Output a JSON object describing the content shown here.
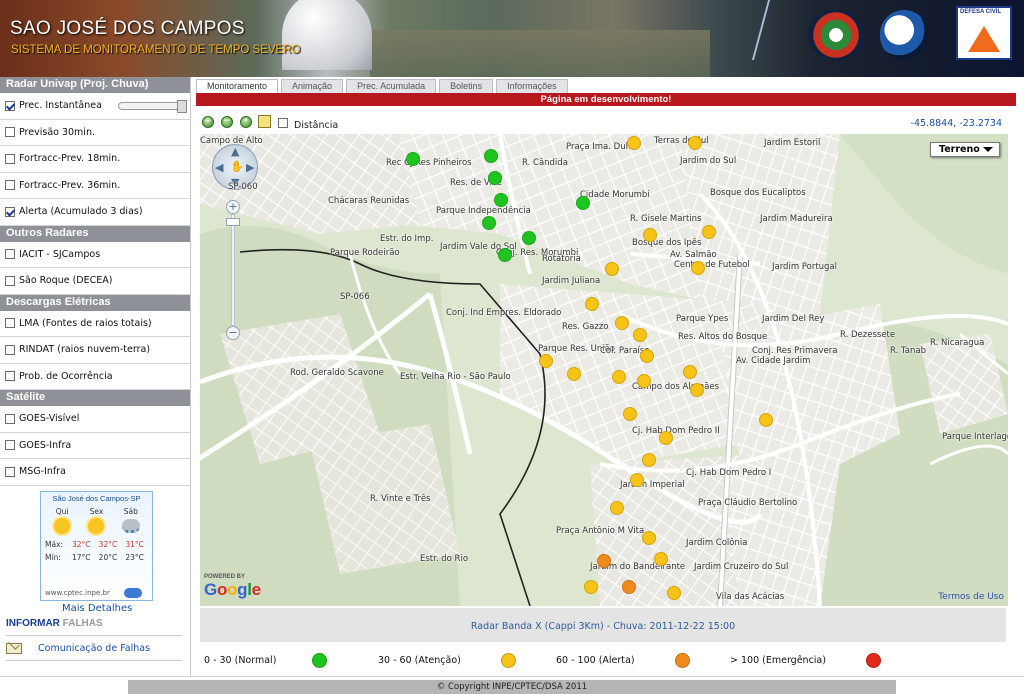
{
  "header": {
    "title": "SAO JOSÉ DOS CAMPOS",
    "subtitle": "SISTEMA DE MONITORAMENTO DE TEMPO SEVERO",
    "logo_label_3": "DEFESA CIVIL",
    "logos": [
      "pro-inovacao-logo",
      "inpe-logo",
      "defesa-civil-logo"
    ]
  },
  "sidebar": {
    "sections": [
      {
        "title": "Radar Univap (Proj. Chuva)",
        "items": [
          {
            "label": "Prec. Instantânea",
            "checked": true,
            "slider": true
          },
          {
            "label": "Previsão 30min.",
            "checked": false
          },
          {
            "label": "Fortracc-Prev. 18min.",
            "checked": false
          },
          {
            "label": "Fortracc-Prev. 36min.",
            "checked": false
          },
          {
            "label": "Alerta (Acumulado 3 dias)",
            "checked": true
          }
        ]
      },
      {
        "title": "Outros Radares",
        "items": [
          {
            "label": "IACIT - SJCampos",
            "checked": false
          },
          {
            "label": "São Roque (DECEA)",
            "checked": false
          }
        ]
      },
      {
        "title": "Descargas Elétricas",
        "items": [
          {
            "label": "LMA (Fontes de raios totais)",
            "checked": false
          },
          {
            "label": "RINDAT (raios nuvem-terra)",
            "checked": false
          },
          {
            "label": "Prob. de Ocorrência",
            "checked": false
          }
        ]
      },
      {
        "title": "Satélite",
        "items": [
          {
            "label": "GOES-Visível",
            "checked": false
          },
          {
            "label": "GOES-Infra",
            "checked": false
          },
          {
            "label": "MSG-Infra",
            "checked": false
          }
        ]
      }
    ],
    "weather": {
      "title": "São José dos Campos-SP",
      "days": [
        {
          "name": "Qui",
          "icon": "sun-cloud-icon",
          "max": "32°C",
          "min": "17°C"
        },
        {
          "name": "Sex",
          "icon": "sun-icon",
          "max": "32°C",
          "min": "20°C"
        },
        {
          "name": "Sáb",
          "icon": "rain-icon",
          "max": "31°C",
          "min": "23°C"
        }
      ],
      "max_label": "Máx:",
      "min_label": "Mín:",
      "source": "www.cptec.inpe.br"
    },
    "more_details": "Mais Detalhes",
    "informar": {
      "a": "INFORMAR",
      "b": "FALHAS"
    },
    "comunicacao": "Comunicação de Falhas"
  },
  "tabs": [
    "Monitoramento",
    "Animação",
    "Prec. Acumulada",
    "Boletins",
    "Informações"
  ],
  "active_tab": 0,
  "dev_banner": "Página em desenvolvimento!",
  "toolbar": {
    "distance_label": "Distância",
    "distance_checked": false,
    "coords": "-45.8844, -23.2734"
  },
  "map": {
    "type_selector": "Terreno",
    "terms": "Termos de Uso",
    "powered_by": "POWERED BY",
    "google": "Google",
    "labels": [
      "Campo de Alto",
      "Rec Cj Res Pinheiros",
      "Res. de Ville",
      "R. Cândida",
      "Praça Ima. Dulce",
      "Cidade Morumbi",
      "Terras do Sul",
      "Jardim Estoril",
      "Jardim do Sul",
      "Bosque dos Eucaliptos",
      "Jardim Madureira",
      "Chácaras Reunidas",
      "Parque Independência",
      "Jardim Vale do Sol",
      "Conj. Res. Morumbi",
      "Rotatória",
      "Bosque dos Ipês",
      "Centro de Futebol",
      "Jardim Portugal",
      "Parque Rodeirão",
      "Jardim Juliana",
      "Conj. Ind Empres. Eldorado",
      "Res. Gazzo",
      "Parque Ypes",
      "Res. Altos do Bosque",
      "Jardim Del Rey",
      "Parque Res. União",
      "Col. Paraíso",
      "Conj. Res Primavera",
      "Campo dos Alemães",
      "Cj. Hab Dom Pedro II",
      "Cj. Hab Dom Pedro I",
      "Jardim Imperial",
      "Praça Cláudio Bertolino",
      "Parque Interlagos",
      "Praça Antônio M Vita",
      "Jardim Colônia",
      "Jardim do Bandeirante",
      "Jardim Cruzeiro do Sul",
      "Vila das Acácias",
      "SP-060",
      "SP-066",
      "Estr. Velha Rio - São Paulo",
      "Rod. Geraldo Scavone",
      "Av. Cidade Jardim",
      "Av. Salmão",
      "R. Gisele Martins",
      "Estr. do Imp.",
      "Estr. do Rio",
      "R. Tanab",
      "R. Nicaragua",
      "R. Dezessete",
      "R. Vinte e Três"
    ],
    "rain_points": [
      {
        "level": "normal",
        "lon": -45.9098,
        "lat": -23.233
      },
      {
        "level": "normal",
        "lon": -45.898,
        "lat": -23.2325
      },
      {
        "level": "normal",
        "lon": -45.8974,
        "lat": -23.236
      },
      {
        "level": "normal",
        "lon": -45.8965,
        "lat": -23.2395
      },
      {
        "level": "normal",
        "lon": -45.8983,
        "lat": -23.2432
      },
      {
        "level": "normal",
        "lon": -45.896,
        "lat": -23.2482
      },
      {
        "level": "normal",
        "lon": -45.8923,
        "lat": -23.2455
      },
      {
        "level": "normal",
        "lon": -45.8842,
        "lat": -23.24
      },
      {
        "level": "atencao",
        "lon": -45.8765,
        "lat": -23.2305
      },
      {
        "level": "atencao",
        "lon": -45.8672,
        "lat": -23.2305
      },
      {
        "level": "atencao",
        "lon": -45.874,
        "lat": -23.245
      },
      {
        "level": "atencao",
        "lon": -45.8652,
        "lat": -23.2445
      },
      {
        "level": "atencao",
        "lon": -45.8798,
        "lat": -23.2505
      },
      {
        "level": "atencao",
        "lon": -45.8668,
        "lat": -23.2503
      },
      {
        "level": "atencao",
        "lon": -45.8828,
        "lat": -23.256
      },
      {
        "level": "atencao",
        "lon": -45.8783,
        "lat": -23.259
      },
      {
        "level": "atencao",
        "lon": -45.8756,
        "lat": -23.261
      },
      {
        "level": "atencao",
        "lon": -45.8745,
        "lat": -23.2643
      },
      {
        "level": "atencao",
        "lon": -45.8898,
        "lat": -23.265
      },
      {
        "level": "atencao",
        "lon": -45.8855,
        "lat": -23.2672
      },
      {
        "level": "atencao",
        "lon": -45.8788,
        "lat": -23.2676
      },
      {
        "level": "atencao",
        "lon": -45.875,
        "lat": -23.2682
      },
      {
        "level": "atencao",
        "lon": -45.868,
        "lat": -23.2668
      },
      {
        "level": "atencao",
        "lon": -45.867,
        "lat": -23.2697
      },
      {
        "level": "atencao",
        "lon": -45.877,
        "lat": -23.2735
      },
      {
        "level": "atencao",
        "lon": -45.8716,
        "lat": -23.2773
      },
      {
        "level": "atencao",
        "lon": -45.8742,
        "lat": -23.2808
      },
      {
        "level": "atencao",
        "lon": -45.876,
        "lat": -23.284
      },
      {
        "level": "atencao",
        "lon": -45.879,
        "lat": -23.2885
      },
      {
        "level": "atencao",
        "lon": -45.8742,
        "lat": -23.2932
      },
      {
        "level": "atencao",
        "lon": -45.8724,
        "lat": -23.2965
      },
      {
        "level": "atencao",
        "lon": -45.883,
        "lat": -23.301
      },
      {
        "level": "atencao",
        "lon": -45.8705,
        "lat": -23.302
      },
      {
        "level": "atencao",
        "lon": -45.8565,
        "lat": -23.2745
      },
      {
        "level": "alerta",
        "lon": -45.881,
        "lat": -23.2968
      },
      {
        "level": "alerta",
        "lon": -45.8772,
        "lat": -23.301
      }
    ]
  },
  "radar_info": "Radar Banda X (Cappi 3Km) - Chuva: 2011-12-22 15:00",
  "legend": [
    {
      "label": "0 - 30 (Normal)",
      "color": "#1fc51f"
    },
    {
      "label": "30 - 60 (Atenção)",
      "color": "#f7c316"
    },
    {
      "label": "60 - 100 (Alerta)",
      "color": "#f08a1c"
    },
    {
      "label": "> 100 (Emergência)",
      "color": "#e22a1c"
    }
  ],
  "colors": {
    "normal": "#1fc51f",
    "atencao": "#f7c316",
    "alerta": "#f08a1c",
    "emergencia": "#e22a1c",
    "banner": "#b7181e",
    "section_header": "#8f9198"
  },
  "footer": "© Copyright INPE/CPTEC/DSA 2011"
}
